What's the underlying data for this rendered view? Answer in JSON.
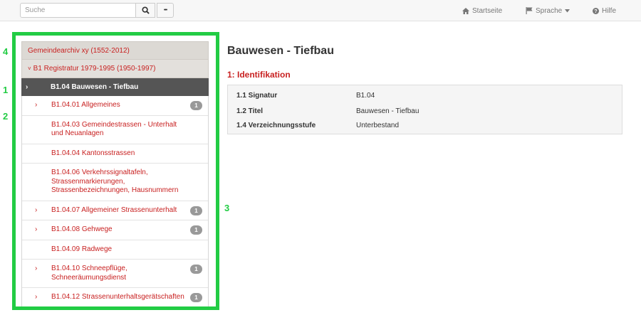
{
  "topbar": {
    "search_placeholder": "Suche",
    "more_label": "•••",
    "nav": {
      "home": "Startseite",
      "language": "Sprache",
      "help": "Hilfe"
    }
  },
  "annotations": [
    "4",
    "1",
    "2",
    "3"
  ],
  "tree": {
    "archive": "Gemeindearchiv xy (1552-2012)",
    "registry": "B1 Registratur 1979-1995 (1950-1997)",
    "active": "B1.04 Bauwesen - Tiefbau",
    "items": [
      {
        "label": "B1.04.01 Allgemeines",
        "count": "1",
        "has_children": true
      },
      {
        "label": "B1.04.03 Gemeindestrassen - Unterhalt und Neuanlagen",
        "count": "",
        "has_children": false
      },
      {
        "label": "B1.04.04 Kantonsstrassen",
        "count": "",
        "has_children": false
      },
      {
        "label": "B1.04.06 Verkehrssignaltafeln, Strassenmarkierungen, Strassenbezeichnungen, Hausnummern",
        "count": "",
        "has_children": false
      },
      {
        "label": "B1.04.07 Allgemeiner Strassenunterhalt",
        "count": "1",
        "has_children": true
      },
      {
        "label": "B1.04.08 Gehwege",
        "count": "1",
        "has_children": true
      },
      {
        "label": "B1.04.09 Radwege",
        "count": "",
        "has_children": false
      },
      {
        "label": "B1.04.10 Schneepflüge, Schneeräumungsdienst",
        "count": "1",
        "has_children": true
      },
      {
        "label": "B1.04.12 Strassenunterhaltsgerätschaften",
        "count": "1",
        "has_children": true
      }
    ]
  },
  "detail": {
    "title": "Bauwesen - Tiefbau",
    "section": "1: Identifikation",
    "fields": [
      {
        "key": "1.1 Signatur",
        "value": "B1.04"
      },
      {
        "key": "1.2 Titel",
        "value": "Bauwesen - Tiefbau"
      },
      {
        "key": "1.4 Verzeichnungsstufe",
        "value": "Unterbestand"
      }
    ]
  },
  "colors": {
    "link_red": "#c82121",
    "active_bg": "#555555",
    "annotation_green": "#22cc44",
    "badge_grey": "#999999"
  }
}
